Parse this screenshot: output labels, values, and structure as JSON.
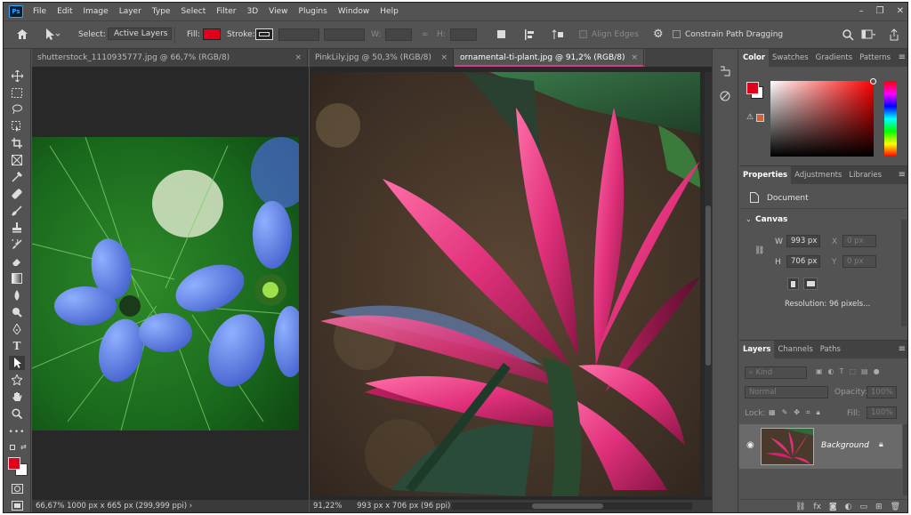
{
  "app": {
    "logo": "Ps"
  },
  "menu": [
    "File",
    "Edit",
    "Image",
    "Layer",
    "Type",
    "Select",
    "Filter",
    "3D",
    "View",
    "Plugins",
    "Window",
    "Help"
  ],
  "window_controls": {
    "minimize": "–",
    "restore": "❐",
    "close": "✕"
  },
  "options": {
    "select_label": "Select:",
    "select_value": "Active Layers",
    "fill_label": "Fill:",
    "fill_color": "#e3001b",
    "stroke_label": "Stroke:",
    "w_label": "W:",
    "h_label": "H:",
    "align_edges": "Align Edges",
    "constrain": "Constrain Path Dragging"
  },
  "documents": [
    {
      "tab": "shutterstock_1110935777.jpg @ 66,7% (RGB/8)",
      "zoom": "66,67%",
      "status": "1000 px x 665 px (299,999 ppi)"
    },
    {
      "tab": "PinkLily.jpg @ 50,3% (RGB/8)"
    },
    {
      "tab": "ornamental-ti-plant.jpg @ 91,2% (RGB/8)",
      "zoom": "91,22%",
      "status": "993 px x 706 px (96 ppi)"
    }
  ],
  "color_panel": {
    "tabs": [
      "Color",
      "Swatches",
      "Gradients",
      "Patterns"
    ],
    "foreground": "#e3001b",
    "background": "#ffffff"
  },
  "properties": {
    "tabs": [
      "Properties",
      "Adjustments",
      "Libraries"
    ],
    "type": "Document",
    "section": "Canvas",
    "w_label": "W",
    "w_value": "993 px",
    "h_label": "H",
    "h_value": "706 px",
    "x_label": "X",
    "x_value": "0 px",
    "y_label": "Y",
    "y_value": "0 px",
    "resolution": "Resolution: 96 pixels..."
  },
  "layers": {
    "tabs": [
      "Layers",
      "Channels",
      "Paths"
    ],
    "kind_placeholder": "Kind",
    "blend_mode": "Normal",
    "opacity_label": "Opacity:",
    "opacity_value": "100%",
    "lock_label": "Lock:",
    "fill_label": "Fill:",
    "fill_value": "100%",
    "items": [
      {
        "name": "Background"
      }
    ]
  },
  "colors": {
    "accent": "#d43c8a",
    "panel": "#535353",
    "dark": "#424242"
  }
}
